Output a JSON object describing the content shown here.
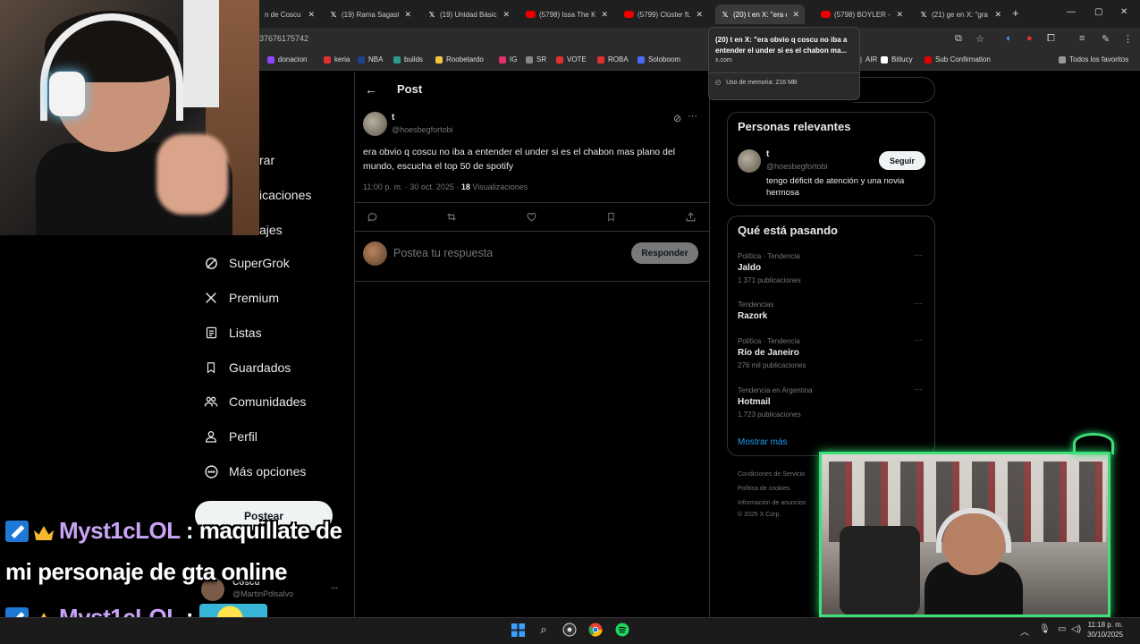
{
  "browser": {
    "tabs": [
      {
        "label": "n de Coscu",
        "icon": "none",
        "active": false
      },
      {
        "label": "(19) Rama Sagast",
        "icon": "x",
        "active": false
      },
      {
        "label": "(19) Unidad Básic",
        "icon": "x",
        "active": false
      },
      {
        "label": "(5798) Issa The Ki",
        "icon": "youtube",
        "active": false
      },
      {
        "label": "(5799) Clúster ft.",
        "icon": "youtube",
        "active": false
      },
      {
        "label": "(20) t en X: \"era o",
        "icon": "x",
        "active": true
      },
      {
        "label": "(5798) BOYLER - I",
        "icon": "youtube",
        "active": false
      },
      {
        "label": "(21) ge en X: \"gra",
        "icon": "x",
        "active": false
      }
    ],
    "url_fragment": "37676175742",
    "bookmarks": [
      {
        "label": "donacion",
        "color": "#9146ff"
      },
      {
        "label": "keria",
        "color": "#e03030"
      },
      {
        "label": "NBA",
        "color": "#1d428a"
      },
      {
        "label": "builds",
        "color": "#2a9d8f"
      },
      {
        "label": "Roobetardo",
        "color": "#f4c542"
      },
      {
        "label": "IG",
        "color": "#e1306c"
      },
      {
        "label": "SR",
        "color": "#888888"
      },
      {
        "label": "VOTE",
        "color": "#e03030"
      },
      {
        "label": "ROBA",
        "color": "#e03030"
      },
      {
        "label": "Soloboom",
        "color": "#4a6cf7"
      },
      {
        "label": "AIR",
        "color": "#666666"
      },
      {
        "label": "Bitlucy",
        "color": "#ffffff"
      },
      {
        "label": "Sub Confirmation",
        "color": "#e00000"
      },
      {
        "label": "Todos los favoritos",
        "color": "#999999"
      }
    ],
    "tooltip": {
      "title_line1": "(20) t en X: \"era obvio q coscu no iba a",
      "title_line2": "entender el under si es el chabon ma...",
      "domain": "x.com",
      "memory": "Uso de memoria: 216 MB"
    }
  },
  "x_nav": {
    "partial_items": [
      "rar",
      "icaciones",
      "ajes"
    ],
    "items": [
      {
        "label": "SuperGrok",
        "icon": "grok-icon"
      },
      {
        "label": "Premium",
        "icon": "x-logo-icon"
      },
      {
        "label": "Listas",
        "icon": "list-icon"
      },
      {
        "label": "Guardados",
        "icon": "bookmark-icon"
      },
      {
        "label": "Comunidades",
        "icon": "communities-icon"
      },
      {
        "label": "Perfil",
        "icon": "profile-icon"
      },
      {
        "label": "Más opciones",
        "icon": "more-circle-icon"
      }
    ],
    "post_button": "Postear",
    "account": {
      "name": "Coscu",
      "handle": "@MartinPdisalvo",
      "more": "..."
    }
  },
  "post": {
    "header_title": "Post",
    "author_name": "t",
    "author_handle": "@hoesbegfortobi",
    "text": "era obvio q coscu no iba a entender el under si es el chabon mas plano del mundo, escucha el top 50 de spotify",
    "timestamp": "11:00 p. m. · 30 oct. 2025 · ",
    "views_count": "18",
    "views_label": " Visualizaciones",
    "reply_placeholder": "Postea tu respuesta",
    "reply_button": "Responder"
  },
  "relevant": {
    "title": "Personas relevantes",
    "name": "t",
    "handle": "@hoesbegfortobi",
    "bio": "tengo déficit de atención y una novia hermosa",
    "follow_button": "Seguir"
  },
  "trends": {
    "title": "Qué está pasando",
    "items": [
      {
        "category": "Política · Tendencia",
        "name": "Jaldo",
        "count": "1.371 publicaciones"
      },
      {
        "category": "Tendencias",
        "name": "Razork",
        "count": ""
      },
      {
        "category": "Política · Tendencia",
        "name": "Río de Janeiro",
        "count": "276 mil publicaciones"
      },
      {
        "category": "Tendencia en Argentina",
        "name": "Hotmail",
        "count": "1.723 publicaciones"
      }
    ],
    "show_more": "Mostrar más"
  },
  "footer": {
    "links": [
      "Condiciones de Servicio",
      "Política de cookies",
      "Información de anuncios"
    ],
    "copyright": "© 2025 X Corp."
  },
  "chat": {
    "line1_user": "Myst1cLOL",
    "line1_text": " : maquillate de",
    "line2_text": "mi personaje de gta online",
    "line3_user": "Myst1cLOL",
    "line3_text": " :"
  },
  "taskbar": {
    "time": "11:18 p. m.",
    "date": "30/10/2025"
  },
  "colors": {
    "accent_blue": "#1d9bf0",
    "chat_username": "#c9a3f5",
    "cam_border": "#3fe07a"
  }
}
